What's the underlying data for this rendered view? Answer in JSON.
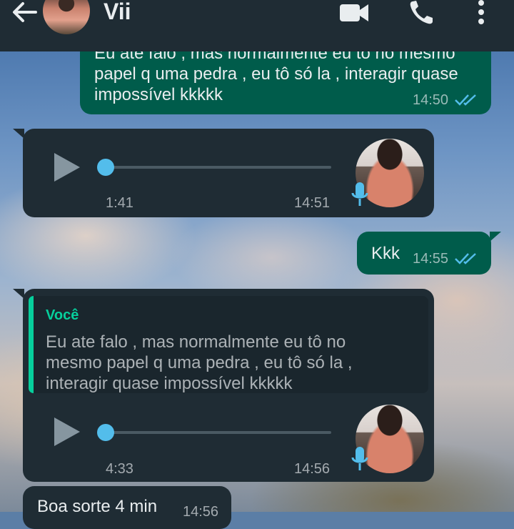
{
  "header": {
    "contact_name": "Vii",
    "back_icon": "arrow-left-icon",
    "video_icon": "video-camera-icon",
    "call_icon": "phone-icon",
    "menu_icon": "more-vertical-icon"
  },
  "messages": [
    {
      "type": "outgoing-text",
      "lines": [
        "Eu ate falo , mas normalmente eu tô no mesmo",
        "papel q uma pedra , eu tô só la , interagir quase",
        "impossível kkkkk"
      ],
      "time": "14:50",
      "status": "read"
    },
    {
      "type": "incoming-voice",
      "duration": "1:41",
      "time": "14:51",
      "progress": 0
    },
    {
      "type": "outgoing-text",
      "lines": [
        "Kkk"
      ],
      "time": "14:55",
      "status": "read"
    },
    {
      "type": "incoming-voice-reply",
      "quote_author": "Você",
      "quote_lines": [
        "Eu ate falo , mas normalmente eu tô no",
        "mesmo papel q uma pedra , eu tô só la ,",
        "interagir quase impossível kkkkk"
      ],
      "duration": "4:33",
      "time": "14:56",
      "progress": 0
    },
    {
      "type": "incoming-text",
      "lines": [
        "Boa sorte 4 min"
      ],
      "time": "14:56"
    }
  ],
  "colors": {
    "outgoing_bubble": "#005c4b",
    "incoming_bubble": "#1f2c34",
    "accent": "#06cf9c",
    "read_ticks": "#53bdeb"
  }
}
